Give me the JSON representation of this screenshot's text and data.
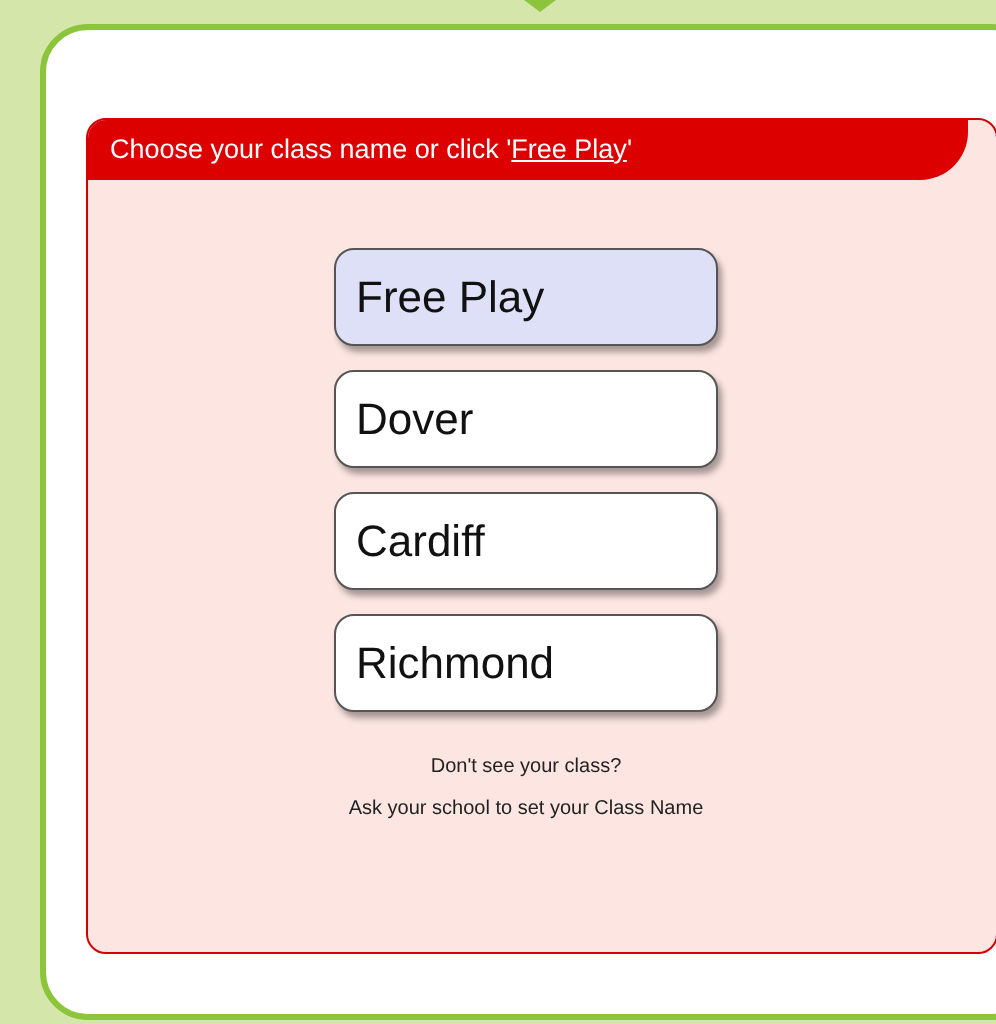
{
  "header": {
    "text_before": "Choose your class name or click '",
    "link": "Free Play",
    "text_after": "'"
  },
  "classes": [
    {
      "label": "Free Play",
      "selected": true
    },
    {
      "label": "Dover",
      "selected": false
    },
    {
      "label": "Cardiff",
      "selected": false
    },
    {
      "label": "Richmond",
      "selected": false
    }
  ],
  "help": [
    "Don't see your class?",
    "Ask your school to set your Class Name"
  ]
}
